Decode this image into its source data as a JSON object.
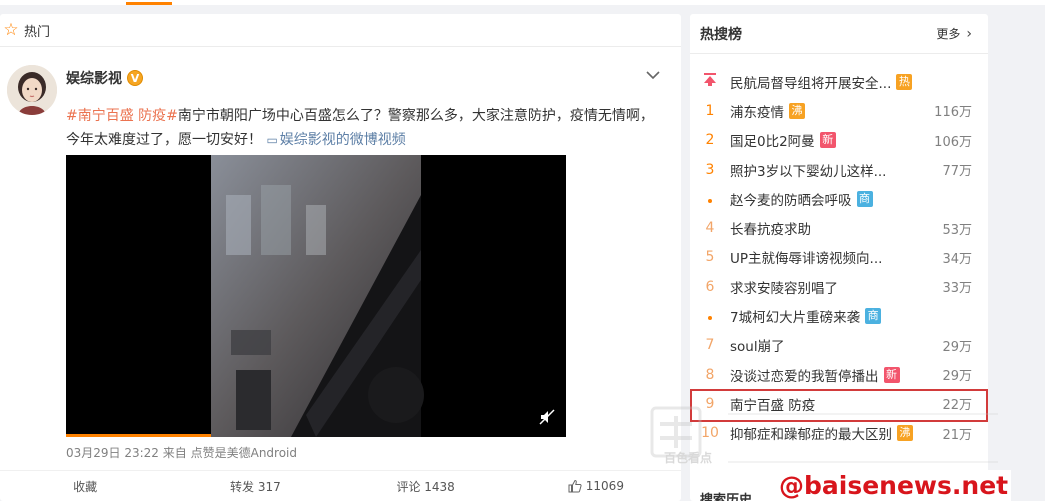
{
  "top_tab_accent": "#ff8200",
  "feed": {
    "header_label": "热门",
    "post": {
      "author": "娱综影视",
      "verified_badge": "V",
      "text_parts": [
        {
          "kind": "tag",
          "text": "#南宁百盛 防疫#"
        },
        {
          "kind": "plain",
          "text": "南宁市朝阳广场中心百盛怎么了？警察那么多，大家注意防护，疫情无情啊，今年太难度过了，愿一切安好！ "
        },
        {
          "kind": "link",
          "text": "娱综影视的微博视频"
        }
      ],
      "video_progress": 0.29,
      "timestamp": "03月29日 23:22",
      "source_prefix": "来自",
      "source": "点赞是美德Android"
    },
    "actions": {
      "favorite": "收藏",
      "repost": "转发 317",
      "comment": "评论 1438",
      "like": "11069"
    }
  },
  "hot_search": {
    "title": "热搜榜",
    "more": "更多",
    "items": [
      {
        "rank": "",
        "marker": "pin",
        "title": "民航局督导组将开展安全...",
        "badge": "热",
        "badge_type": "hot-b",
        "count": ""
      },
      {
        "rank": "1",
        "marker": "num",
        "title": "浦东疫情",
        "badge": "沸",
        "badge_type": "boil",
        "count": "116万"
      },
      {
        "rank": "2",
        "marker": "num",
        "title": "国足0比2阿曼",
        "badge": "新",
        "badge_type": "new",
        "count": "106万"
      },
      {
        "rank": "3",
        "marker": "num",
        "title": "照护3岁以下婴幼儿这样...",
        "badge": "",
        "badge_type": "",
        "count": "77万"
      },
      {
        "rank": "",
        "marker": "dot",
        "title": "赵今麦的防晒会呼吸",
        "badge": "商",
        "badge_type": "biz",
        "count": ""
      },
      {
        "rank": "4",
        "marker": "num",
        "title": "长春抗疫求助",
        "badge": "",
        "badge_type": "",
        "count": "53万"
      },
      {
        "rank": "5",
        "marker": "num",
        "title": "UP主就侮辱诽谤视频向...",
        "badge": "",
        "badge_type": "",
        "count": "34万"
      },
      {
        "rank": "6",
        "marker": "num",
        "title": "求求安陵容别唱了",
        "badge": "",
        "badge_type": "",
        "count": "33万"
      },
      {
        "rank": "",
        "marker": "dot",
        "title": "7城柯幻大片重磅来袭",
        "badge": "商",
        "badge_type": "biz",
        "count": ""
      },
      {
        "rank": "7",
        "marker": "num",
        "title": "soul崩了",
        "badge": "",
        "badge_type": "",
        "count": "29万"
      },
      {
        "rank": "8",
        "marker": "num",
        "title": "没谈过恋爱的我暂停播出",
        "badge": "新",
        "badge_type": "new",
        "count": "29万"
      },
      {
        "rank": "9",
        "marker": "num",
        "title": "南宁百盛 防疫",
        "badge": "",
        "badge_type": "",
        "count": "22万",
        "highlighted": true
      },
      {
        "rank": "10",
        "marker": "num",
        "title": "抑郁症和躁郁症的最大区别",
        "badge": "沸",
        "badge_type": "boil",
        "count": "21万"
      }
    ],
    "search_history": "搜索历史"
  },
  "watermark": {
    "logo_text": "百色看点",
    "big_text": "百色看点",
    "url": "@baisenews.net"
  }
}
